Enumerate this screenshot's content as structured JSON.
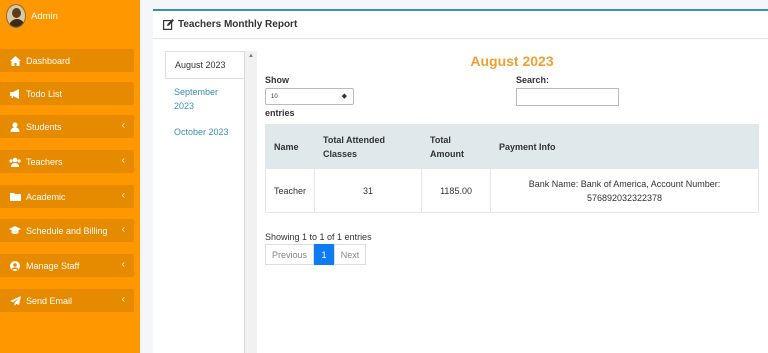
{
  "user": {
    "name": "Admin"
  },
  "nav": [
    {
      "label": "Dashboard",
      "icon": "home-icon",
      "chevron": false
    },
    {
      "label": "Todo List",
      "icon": "megaphone-icon",
      "chevron": false
    },
    {
      "label": "Students",
      "icon": "user-icon",
      "chevron": true
    },
    {
      "label": "Teachers",
      "icon": "users-icon",
      "chevron": true
    },
    {
      "label": "Academic",
      "icon": "folder-icon",
      "chevron": true
    },
    {
      "label": "Schedule and Billing",
      "icon": "graduation-cap-icon",
      "chevron": true
    },
    {
      "label": "Manage Staff",
      "icon": "user-circle-icon",
      "chevron": true
    },
    {
      "label": "Send Email",
      "icon": "paper-plane-icon",
      "chevron": true
    }
  ],
  "card": {
    "title": "Teachers Monthly Report"
  },
  "months": [
    "August 2023",
    "September 2023",
    "October 2023"
  ],
  "report": {
    "title": "August 2023",
    "show_label": "Show",
    "show_value": "10",
    "entries_label": "entries",
    "search_label": "Search:",
    "search_value": ""
  },
  "table": {
    "headers": [
      "Name",
      "Total Attended Classes",
      "Total Amount",
      "Payment Info"
    ],
    "rows": [
      [
        "Teacher",
        "31",
        "1185.00",
        "Bank Name: Bank of America, Account Number: 576892032322378"
      ]
    ]
  },
  "footer": {
    "info": "Showing 1 to 1 of 1 entries",
    "prev": "Previous",
    "page": "1",
    "next": "Next"
  },
  "colors": {
    "sidebar": "#ff9800",
    "nav_item": "#e68a00",
    "title": "#f0a030",
    "active_page": "#0d7bf2"
  }
}
